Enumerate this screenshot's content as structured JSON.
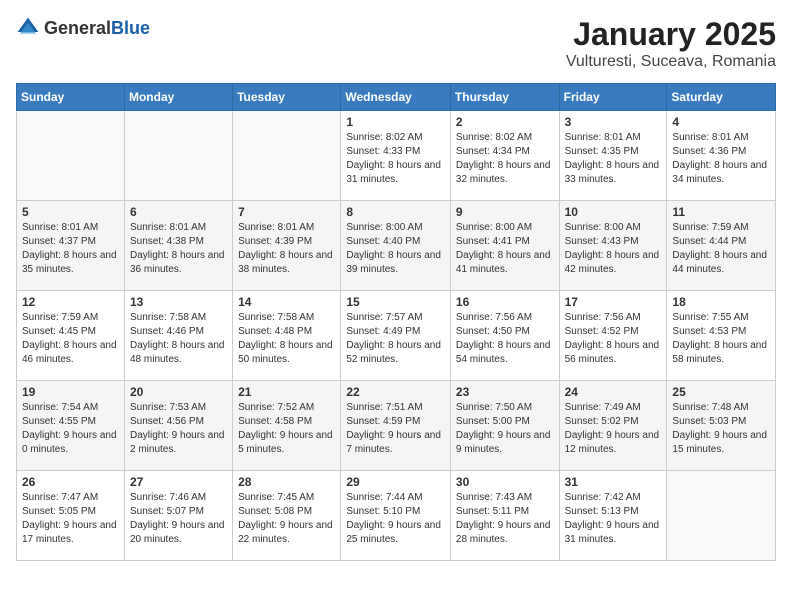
{
  "header": {
    "logo": {
      "general": "General",
      "blue": "Blue"
    },
    "title": "January 2025",
    "location": "Vulturesti, Suceava, Romania"
  },
  "weekdays": [
    "Sunday",
    "Monday",
    "Tuesday",
    "Wednesday",
    "Thursday",
    "Friday",
    "Saturday"
  ],
  "weeks": [
    [
      {
        "day": "",
        "content": ""
      },
      {
        "day": "",
        "content": ""
      },
      {
        "day": "",
        "content": ""
      },
      {
        "day": "1",
        "content": "Sunrise: 8:02 AM\nSunset: 4:33 PM\nDaylight: 8 hours and 31 minutes."
      },
      {
        "day": "2",
        "content": "Sunrise: 8:02 AM\nSunset: 4:34 PM\nDaylight: 8 hours and 32 minutes."
      },
      {
        "day": "3",
        "content": "Sunrise: 8:01 AM\nSunset: 4:35 PM\nDaylight: 8 hours and 33 minutes."
      },
      {
        "day": "4",
        "content": "Sunrise: 8:01 AM\nSunset: 4:36 PM\nDaylight: 8 hours and 34 minutes."
      }
    ],
    [
      {
        "day": "5",
        "content": "Sunrise: 8:01 AM\nSunset: 4:37 PM\nDaylight: 8 hours and 35 minutes."
      },
      {
        "day": "6",
        "content": "Sunrise: 8:01 AM\nSunset: 4:38 PM\nDaylight: 8 hours and 36 minutes."
      },
      {
        "day": "7",
        "content": "Sunrise: 8:01 AM\nSunset: 4:39 PM\nDaylight: 8 hours and 38 minutes."
      },
      {
        "day": "8",
        "content": "Sunrise: 8:00 AM\nSunset: 4:40 PM\nDaylight: 8 hours and 39 minutes."
      },
      {
        "day": "9",
        "content": "Sunrise: 8:00 AM\nSunset: 4:41 PM\nDaylight: 8 hours and 41 minutes."
      },
      {
        "day": "10",
        "content": "Sunrise: 8:00 AM\nSunset: 4:43 PM\nDaylight: 8 hours and 42 minutes."
      },
      {
        "day": "11",
        "content": "Sunrise: 7:59 AM\nSunset: 4:44 PM\nDaylight: 8 hours and 44 minutes."
      }
    ],
    [
      {
        "day": "12",
        "content": "Sunrise: 7:59 AM\nSunset: 4:45 PM\nDaylight: 8 hours and 46 minutes."
      },
      {
        "day": "13",
        "content": "Sunrise: 7:58 AM\nSunset: 4:46 PM\nDaylight: 8 hours and 48 minutes."
      },
      {
        "day": "14",
        "content": "Sunrise: 7:58 AM\nSunset: 4:48 PM\nDaylight: 8 hours and 50 minutes."
      },
      {
        "day": "15",
        "content": "Sunrise: 7:57 AM\nSunset: 4:49 PM\nDaylight: 8 hours and 52 minutes."
      },
      {
        "day": "16",
        "content": "Sunrise: 7:56 AM\nSunset: 4:50 PM\nDaylight: 8 hours and 54 minutes."
      },
      {
        "day": "17",
        "content": "Sunrise: 7:56 AM\nSunset: 4:52 PM\nDaylight: 8 hours and 56 minutes."
      },
      {
        "day": "18",
        "content": "Sunrise: 7:55 AM\nSunset: 4:53 PM\nDaylight: 8 hours and 58 minutes."
      }
    ],
    [
      {
        "day": "19",
        "content": "Sunrise: 7:54 AM\nSunset: 4:55 PM\nDaylight: 9 hours and 0 minutes."
      },
      {
        "day": "20",
        "content": "Sunrise: 7:53 AM\nSunset: 4:56 PM\nDaylight: 9 hours and 2 minutes."
      },
      {
        "day": "21",
        "content": "Sunrise: 7:52 AM\nSunset: 4:58 PM\nDaylight: 9 hours and 5 minutes."
      },
      {
        "day": "22",
        "content": "Sunrise: 7:51 AM\nSunset: 4:59 PM\nDaylight: 9 hours and 7 minutes."
      },
      {
        "day": "23",
        "content": "Sunrise: 7:50 AM\nSunset: 5:00 PM\nDaylight: 9 hours and 9 minutes."
      },
      {
        "day": "24",
        "content": "Sunrise: 7:49 AM\nSunset: 5:02 PM\nDaylight: 9 hours and 12 minutes."
      },
      {
        "day": "25",
        "content": "Sunrise: 7:48 AM\nSunset: 5:03 PM\nDaylight: 9 hours and 15 minutes."
      }
    ],
    [
      {
        "day": "26",
        "content": "Sunrise: 7:47 AM\nSunset: 5:05 PM\nDaylight: 9 hours and 17 minutes."
      },
      {
        "day": "27",
        "content": "Sunrise: 7:46 AM\nSunset: 5:07 PM\nDaylight: 9 hours and 20 minutes."
      },
      {
        "day": "28",
        "content": "Sunrise: 7:45 AM\nSunset: 5:08 PM\nDaylight: 9 hours and 22 minutes."
      },
      {
        "day": "29",
        "content": "Sunrise: 7:44 AM\nSunset: 5:10 PM\nDaylight: 9 hours and 25 minutes."
      },
      {
        "day": "30",
        "content": "Sunrise: 7:43 AM\nSunset: 5:11 PM\nDaylight: 9 hours and 28 minutes."
      },
      {
        "day": "31",
        "content": "Sunrise: 7:42 AM\nSunset: 5:13 PM\nDaylight: 9 hours and 31 minutes."
      },
      {
        "day": "",
        "content": ""
      }
    ]
  ]
}
